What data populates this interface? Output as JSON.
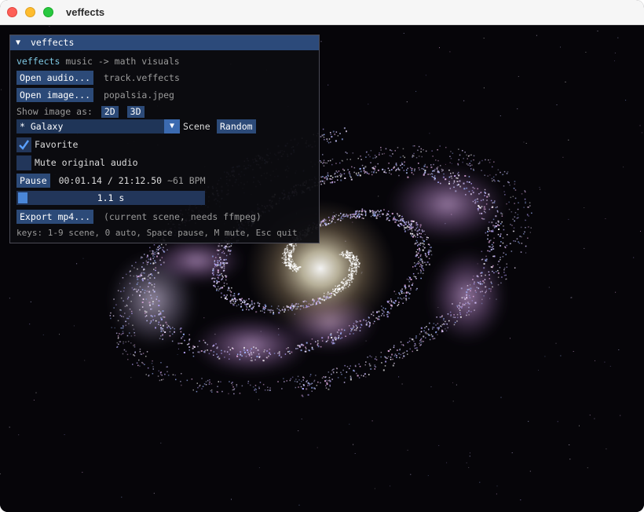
{
  "window": {
    "title": "veffects"
  },
  "panel": {
    "title": "veffects",
    "header_app": "veffects",
    "header_tagline": "music -> math visuals",
    "open_audio_label": "Open audio...",
    "audio_file": "track.veffects",
    "open_image_label": "Open image...",
    "image_file": "popalsia.jpeg",
    "show_image_label": "Show image as:",
    "show_2d_label": "2D",
    "show_3d_label": "3D",
    "scene_selected": "* Galaxy",
    "scene_label": "Scene",
    "random_label": "Random",
    "favorite_label": "Favorite",
    "favorite_checked": true,
    "mute_label": "Mute original audio",
    "mute_checked": false,
    "pause_label": "Pause",
    "time_text": "00:01.14 / 21:12.50",
    "bpm_text": "~61 BPM",
    "progress_fraction": 0.05,
    "progress_text": "1.1 s",
    "export_label": "Export mp4...",
    "export_note": "(current scene, needs ffmpeg)",
    "keys_hint": "keys: 1-9 scene, 0 auto, Space pause, M mute, Esc quit"
  },
  "colors": {
    "accent": "#7ec8e3",
    "button": "#2c4a78",
    "title_bar": "#2c4a7a"
  }
}
